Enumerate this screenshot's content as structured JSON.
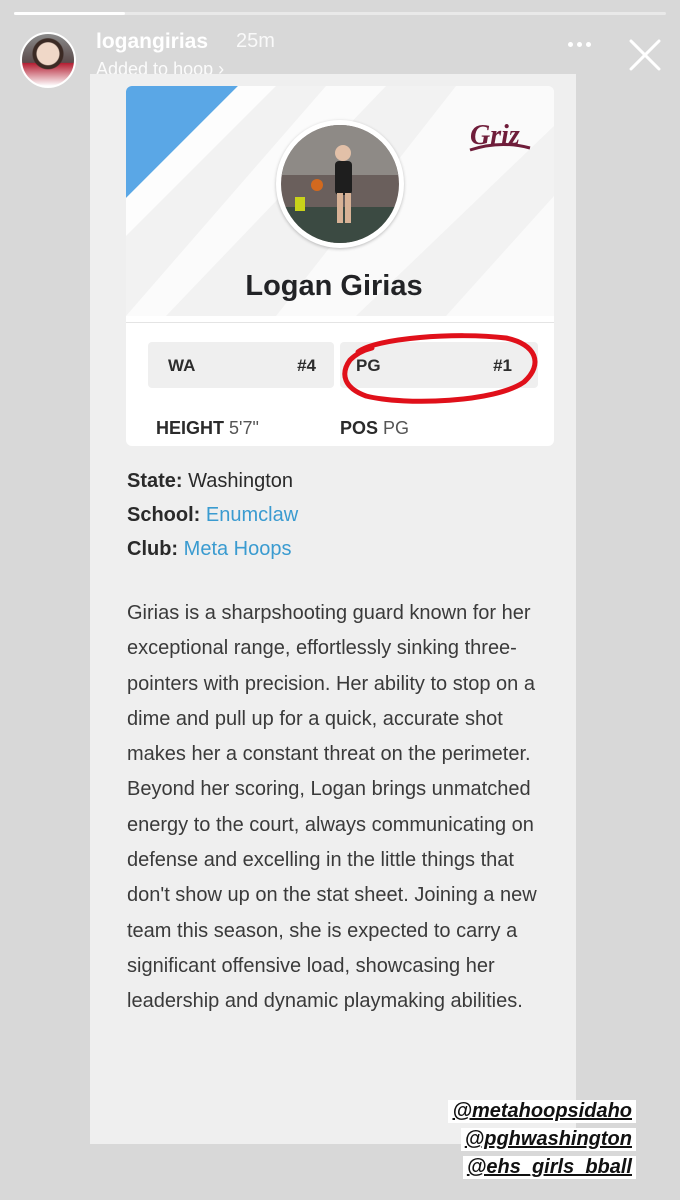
{
  "story": {
    "progress_fraction": 0.17,
    "username": "logangirias",
    "time": "25m",
    "subtitle": "Added to hoop ›"
  },
  "card": {
    "player_name": "Logan Girias",
    "logo_text": "Griz",
    "chips": [
      {
        "label": "WA",
        "rank": "#4"
      },
      {
        "label": "PG",
        "rank": "#1"
      }
    ],
    "stats": [
      {
        "label": "HEIGHT",
        "value": "5'7\""
      },
      {
        "label": "POS",
        "value": "PG"
      }
    ]
  },
  "info": {
    "state_label": "State:",
    "state_value": "Washington",
    "school_label": "School:",
    "school_value": "Enumclaw",
    "club_label": "Club:",
    "club_value": "Meta Hoops"
  },
  "bio": "Girias is a sharpshooting guard known for her exceptional range, effortlessly sinking three-pointers with precision. Her ability to stop on a dime and pull up for a quick, accurate shot makes her a constant threat on the perimeter. Beyond her scoring, Logan brings unmatched energy to the court, always communicating on defense and excelling in the little things that don't show up on the stat sheet. Joining a new team this season, she is expected to carry a significant offensive load, showcasing her leadership and dynamic playmaking abilities.",
  "tags": [
    "@metahoopsidaho",
    "@pghwashington",
    "@ehs_girls_bball"
  ],
  "colors": {
    "accent_blue": "#5aa7e6",
    "link": "#3a9bd0",
    "annotation_red": "#e0101a",
    "griz_maroon": "#6f1d3a"
  }
}
